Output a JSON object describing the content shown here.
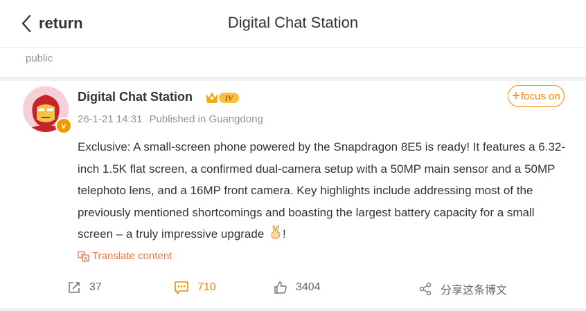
{
  "header": {
    "back_label": "return",
    "title": "Digital Chat Station"
  },
  "section_label": "public",
  "post": {
    "author": "Digital Chat Station",
    "level_badge": "IV",
    "verified_badge": "v",
    "timestamp": "26-1-21 14:31",
    "location": "Published in Guangdong",
    "follow_label": "focus on",
    "text": "Exclusive: A small-screen phone powered by the Snapdragon 8E5 is ready! It features a 6.32-inch 1.5K flat screen, a confirmed dual-camera setup with a 50MP main sensor and a 50MP telephoto lens, and a 16MP front camera. Key highlights include addressing most of the previously mentioned shortcomings and boasting the largest battery capacity for a small screen – a truly impressive upgrade",
    "text_end": "!",
    "emoji": "victory-hand",
    "translate_label": "Translate content"
  },
  "actions": {
    "repost_count": "37",
    "comment_count": "710",
    "like_count": "3404",
    "share_label": "分享这条博文"
  },
  "colors": {
    "accent": "#ff8200",
    "translate": "#eb7340",
    "muted": "#939393"
  }
}
